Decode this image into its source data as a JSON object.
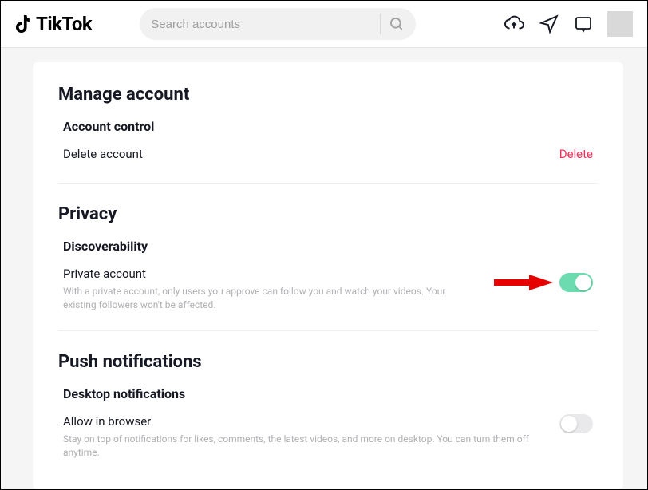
{
  "brand": "TikTok",
  "search": {
    "placeholder": "Search accounts"
  },
  "sections": {
    "manage": {
      "title": "Manage account",
      "accountControl": {
        "title": "Account control",
        "deleteLabel": "Delete account",
        "deleteAction": "Delete"
      }
    },
    "privacy": {
      "title": "Privacy",
      "discoverability": {
        "title": "Discoverability",
        "privateAccount": {
          "label": "Private account",
          "desc": "With a private account, only users you approve can follow you and watch your videos. Your existing followers won't be affected."
        }
      }
    },
    "push": {
      "title": "Push notifications",
      "desktop": {
        "title": "Desktop notifications",
        "allowBrowser": {
          "label": "Allow in browser",
          "desc": "Stay on top of notifications for likes, comments, the latest videos, and more on desktop. You can turn them off anytime."
        }
      }
    }
  }
}
